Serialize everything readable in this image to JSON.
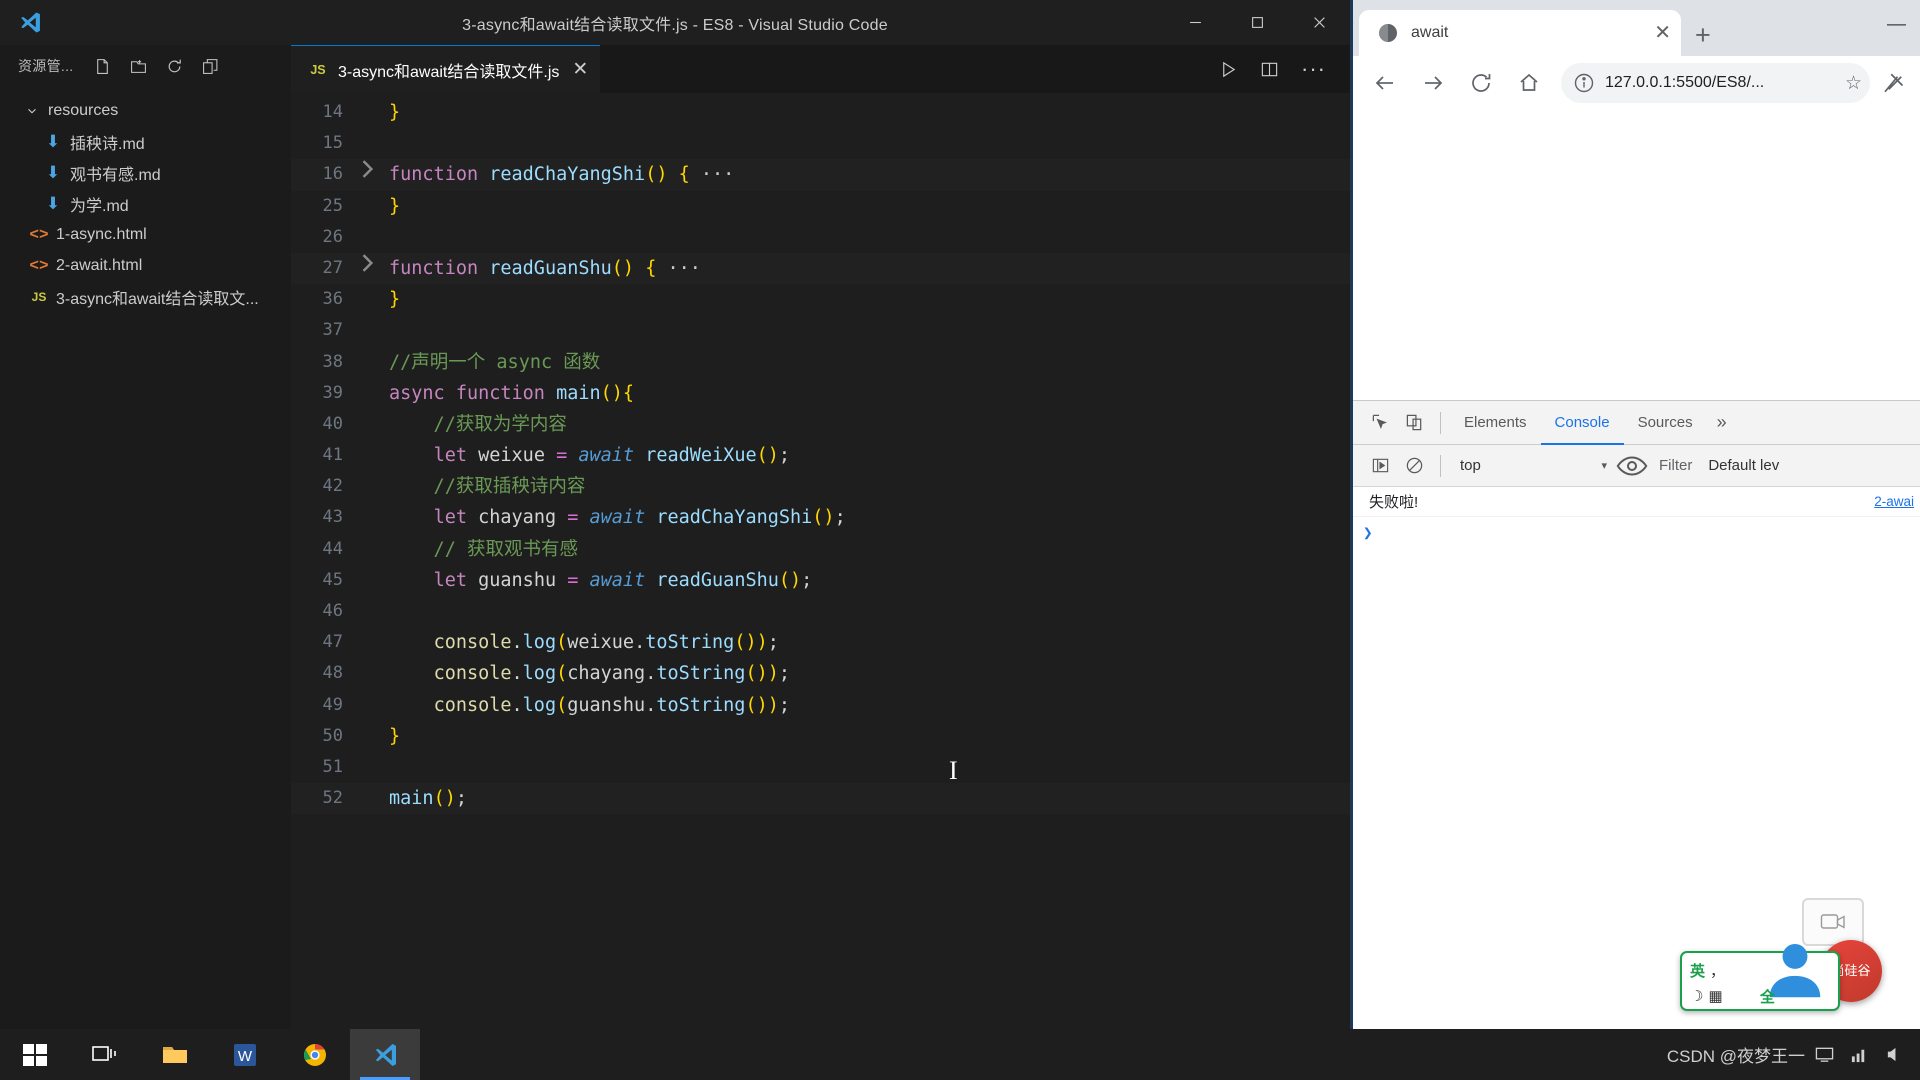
{
  "vscode": {
    "window_title": "3-async和await结合读取文件.js - ES8 - Visual Studio Code",
    "logo_name": "vscode-logo",
    "window_buttons": [
      {
        "name": "minimize-button",
        "label": "—"
      },
      {
        "name": "maximize-button",
        "label": "□"
      },
      {
        "name": "close-button",
        "label": "✕"
      }
    ],
    "sidebar": {
      "title": "资源管...",
      "actions": [
        {
          "name": "new-file-icon",
          "label": "新建文件"
        },
        {
          "name": "new-folder-icon",
          "label": "新建文件夹"
        },
        {
          "name": "refresh-icon",
          "label": "刷新"
        },
        {
          "name": "collapse-all-icon",
          "label": "折叠文件夹"
        }
      ],
      "tree": [
        {
          "label": "resources",
          "icon": "folder-open",
          "level": 1,
          "expanded": true
        },
        {
          "label": "插秧诗.md",
          "icon": "markdown-icon",
          "level": 2
        },
        {
          "label": "观书有感.md",
          "icon": "markdown-icon",
          "level": 2
        },
        {
          "label": "为学.md",
          "icon": "markdown-icon",
          "level": 2
        },
        {
          "label": "1-async.html",
          "icon": "html-icon",
          "level": 1
        },
        {
          "label": "2-await.html",
          "icon": "html-icon",
          "level": 1
        },
        {
          "label": "3-async和await结合读取文...",
          "icon": "js-icon",
          "level": 1
        }
      ]
    },
    "tab": {
      "label": "3-async和await结合读取文件.js",
      "icon": "js-icon",
      "close_label": "✕"
    },
    "tab_actions": [
      {
        "name": "run-code-button",
        "label": "运行"
      },
      {
        "name": "split-editor-button",
        "label": "拆分编辑器"
      },
      {
        "name": "more-actions-button",
        "label": "···"
      }
    ],
    "code_lines": [
      {
        "num": "14",
        "fold": "",
        "partial": true,
        "tokens": [
          {
            "t": "}",
            "c": "t-punc"
          }
        ]
      },
      {
        "num": "15",
        "fold": "",
        "tokens": []
      },
      {
        "num": "16",
        "fold": "chevron-right",
        "highlight": true,
        "tokens": [
          {
            "t": "function",
            "c": "t-kw"
          },
          {
            "t": " ",
            "c": "t-plain"
          },
          {
            "t": "readChaYangShi",
            "c": "t-fname"
          },
          {
            "t": "()",
            "c": "t-punc"
          },
          {
            "t": " ",
            "c": "t-plain"
          },
          {
            "t": "{",
            "c": "t-punc"
          },
          {
            "t": " ···",
            "c": "t-ellip"
          }
        ]
      },
      {
        "num": "25",
        "fold": "",
        "tokens": [
          {
            "t": "}",
            "c": "t-punc"
          }
        ]
      },
      {
        "num": "26",
        "fold": "",
        "tokens": []
      },
      {
        "num": "27",
        "fold": "chevron-right",
        "highlight": true,
        "tokens": [
          {
            "t": "function",
            "c": "t-kw"
          },
          {
            "t": " ",
            "c": "t-plain"
          },
          {
            "t": "readGuanShu",
            "c": "t-fname"
          },
          {
            "t": "()",
            "c": "t-punc"
          },
          {
            "t": " ",
            "c": "t-plain"
          },
          {
            "t": "{",
            "c": "t-punc"
          },
          {
            "t": " ···",
            "c": "t-ellip"
          }
        ]
      },
      {
        "num": "36",
        "fold": "",
        "tokens": [
          {
            "t": "}",
            "c": "t-punc"
          }
        ]
      },
      {
        "num": "37",
        "fold": "",
        "tokens": []
      },
      {
        "num": "38",
        "fold": "",
        "tokens": [
          {
            "t": "//声明一个 async 函数",
            "c": "t-com"
          }
        ]
      },
      {
        "num": "39",
        "fold": "",
        "tokens": [
          {
            "t": "async",
            "c": "t-kw"
          },
          {
            "t": " ",
            "c": "t-plain"
          },
          {
            "t": "function",
            "c": "t-kw"
          },
          {
            "t": " ",
            "c": "t-plain"
          },
          {
            "t": "main",
            "c": "t-fname"
          },
          {
            "t": "(){",
            "c": "t-punc"
          }
        ]
      },
      {
        "num": "40",
        "fold": "",
        "tokens": [
          {
            "t": "    //获取为学内容",
            "c": "t-com"
          }
        ]
      },
      {
        "num": "41",
        "fold": "",
        "tokens": [
          {
            "t": "    ",
            "c": "t-plain"
          },
          {
            "t": "let",
            "c": "t-kw"
          },
          {
            "t": " ",
            "c": "t-plain"
          },
          {
            "t": "weixue",
            "c": "t-plain"
          },
          {
            "t": " ",
            "c": "t-plain"
          },
          {
            "t": "=",
            "c": "t-punc2"
          },
          {
            "t": " ",
            "c": "t-plain"
          },
          {
            "t": "await",
            "c": "t-await"
          },
          {
            "t": " ",
            "c": "t-plain"
          },
          {
            "t": "readWeiXue",
            "c": "t-var"
          },
          {
            "t": "()",
            "c": "t-punc"
          },
          {
            "t": ";",
            "c": "t-plain"
          }
        ]
      },
      {
        "num": "42",
        "fold": "",
        "tokens": [
          {
            "t": "    //获取插秧诗内容",
            "c": "t-com"
          }
        ]
      },
      {
        "num": "43",
        "fold": "",
        "tokens": [
          {
            "t": "    ",
            "c": "t-plain"
          },
          {
            "t": "let",
            "c": "t-kw"
          },
          {
            "t": " ",
            "c": "t-plain"
          },
          {
            "t": "chayang",
            "c": "t-plain"
          },
          {
            "t": " ",
            "c": "t-plain"
          },
          {
            "t": "=",
            "c": "t-punc2"
          },
          {
            "t": " ",
            "c": "t-plain"
          },
          {
            "t": "await",
            "c": "t-await"
          },
          {
            "t": " ",
            "c": "t-plain"
          },
          {
            "t": "readChaYangShi",
            "c": "t-var"
          },
          {
            "t": "()",
            "c": "t-punc"
          },
          {
            "t": ";",
            "c": "t-plain"
          }
        ]
      },
      {
        "num": "44",
        "fold": "",
        "tokens": [
          {
            "t": "    // 获取观书有感",
            "c": "t-com"
          }
        ]
      },
      {
        "num": "45",
        "fold": "",
        "tokens": [
          {
            "t": "    ",
            "c": "t-plain"
          },
          {
            "t": "let",
            "c": "t-kw"
          },
          {
            "t": " ",
            "c": "t-plain"
          },
          {
            "t": "guanshu",
            "c": "t-plain"
          },
          {
            "t": " ",
            "c": "t-plain"
          },
          {
            "t": "=",
            "c": "t-punc2"
          },
          {
            "t": " ",
            "c": "t-plain"
          },
          {
            "t": "await",
            "c": "t-await"
          },
          {
            "t": " ",
            "c": "t-plain"
          },
          {
            "t": "readGuanShu",
            "c": "t-var"
          },
          {
            "t": "()",
            "c": "t-punc"
          },
          {
            "t": ";",
            "c": "t-plain"
          }
        ]
      },
      {
        "num": "46",
        "fold": "",
        "tokens": []
      },
      {
        "num": "47",
        "fold": "",
        "tokens": [
          {
            "t": "    ",
            "c": "t-plain"
          },
          {
            "t": "console",
            "c": "t-con"
          },
          {
            "t": ".",
            "c": "t-plain"
          },
          {
            "t": "log",
            "c": "t-var"
          },
          {
            "t": "(",
            "c": "t-punc"
          },
          {
            "t": "weixue",
            "c": "t-plain"
          },
          {
            "t": ".",
            "c": "t-plain"
          },
          {
            "t": "toString",
            "c": "t-var"
          },
          {
            "t": "())",
            "c": "t-punc"
          },
          {
            "t": ";",
            "c": "t-plain"
          }
        ]
      },
      {
        "num": "48",
        "fold": "",
        "tokens": [
          {
            "t": "    ",
            "c": "t-plain"
          },
          {
            "t": "console",
            "c": "t-con"
          },
          {
            "t": ".",
            "c": "t-plain"
          },
          {
            "t": "log",
            "c": "t-var"
          },
          {
            "t": "(",
            "c": "t-punc"
          },
          {
            "t": "chayang",
            "c": "t-plain"
          },
          {
            "t": ".",
            "c": "t-plain"
          },
          {
            "t": "toString",
            "c": "t-var"
          },
          {
            "t": "())",
            "c": "t-punc"
          },
          {
            "t": ";",
            "c": "t-plain"
          }
        ]
      },
      {
        "num": "49",
        "fold": "",
        "tokens": [
          {
            "t": "    ",
            "c": "t-plain"
          },
          {
            "t": "console",
            "c": "t-con"
          },
          {
            "t": ".",
            "c": "t-plain"
          },
          {
            "t": "log",
            "c": "t-var"
          },
          {
            "t": "(",
            "c": "t-punc"
          },
          {
            "t": "guanshu",
            "c": "t-plain"
          },
          {
            "t": ".",
            "c": "t-plain"
          },
          {
            "t": "toString",
            "c": "t-var"
          },
          {
            "t": "())",
            "c": "t-punc"
          },
          {
            "t": ";",
            "c": "t-plain"
          }
        ]
      },
      {
        "num": "50",
        "fold": "",
        "tokens": [
          {
            "t": "}",
            "c": "t-punc"
          }
        ]
      },
      {
        "num": "51",
        "fold": "",
        "tokens": []
      },
      {
        "num": "52",
        "fold": "",
        "highlight": true,
        "tokens": [
          {
            "t": "main",
            "c": "t-var"
          },
          {
            "t": "()",
            "c": "t-punc"
          },
          {
            "t": ";",
            "c": "t-plain"
          }
        ]
      }
    ]
  },
  "chrome": {
    "tab": {
      "title": "await",
      "favicon": "globe-icon",
      "close_label": "✕"
    },
    "new_tab_label": "+",
    "minimize_label": "—",
    "nav": [
      {
        "name": "back-button",
        "label": "后退"
      },
      {
        "name": "forward-button",
        "label": "前进"
      },
      {
        "name": "reload-button",
        "label": "刷新"
      },
      {
        "name": "home-button",
        "label": "主页"
      }
    ],
    "url": "127.0.0.1:5500/ES8/...",
    "bookmark_label": "☆",
    "extensions_label": "扩展",
    "devtools": {
      "toolbar_icons": [
        {
          "name": "inspect-element-icon",
          "label": "检查元素"
        },
        {
          "name": "device-toolbar-icon",
          "label": "设备模拟"
        }
      ],
      "tabs": [
        {
          "label": "Elements",
          "active": false
        },
        {
          "label": "Console",
          "active": true
        },
        {
          "label": "Sources",
          "active": false
        }
      ],
      "more_tabs_label": "»",
      "console_bar": {
        "clear_label": "清除",
        "context": "top",
        "context_chevron": "▾",
        "filter_placeholder": "Filter",
        "level": "Default lev"
      },
      "messages": [
        {
          "text": "失败啦!",
          "source": "2-awai"
        }
      ],
      "prompt_symbol": "❯"
    }
  },
  "overlays": {
    "ime": {
      "lang": "英",
      "punct": "，",
      "keyboard": "▦",
      "width_mode": "全",
      "moon": "☽",
      "user": "person-icon"
    },
    "badge_text": "尚硅谷",
    "camera_label": "摄像头"
  },
  "taskbar": {
    "items": [
      {
        "name": "start-button",
        "label": "开始",
        "icon": "windows-icon"
      },
      {
        "name": "task-view-button",
        "label": "任务视图",
        "icon": "taskview-icon"
      },
      {
        "name": "file-explorer-button",
        "label": "文件资源管理器",
        "icon": "folder-icon"
      },
      {
        "name": "word-button",
        "label": "Word",
        "icon": "word-icon"
      },
      {
        "name": "chrome-button",
        "label": "Google Chrome",
        "icon": "chrome-icon"
      },
      {
        "name": "vscode-button",
        "label": "Visual Studio Code",
        "icon": "vscode-icon"
      }
    ],
    "watermark": "CSDN @夜梦王一"
  }
}
